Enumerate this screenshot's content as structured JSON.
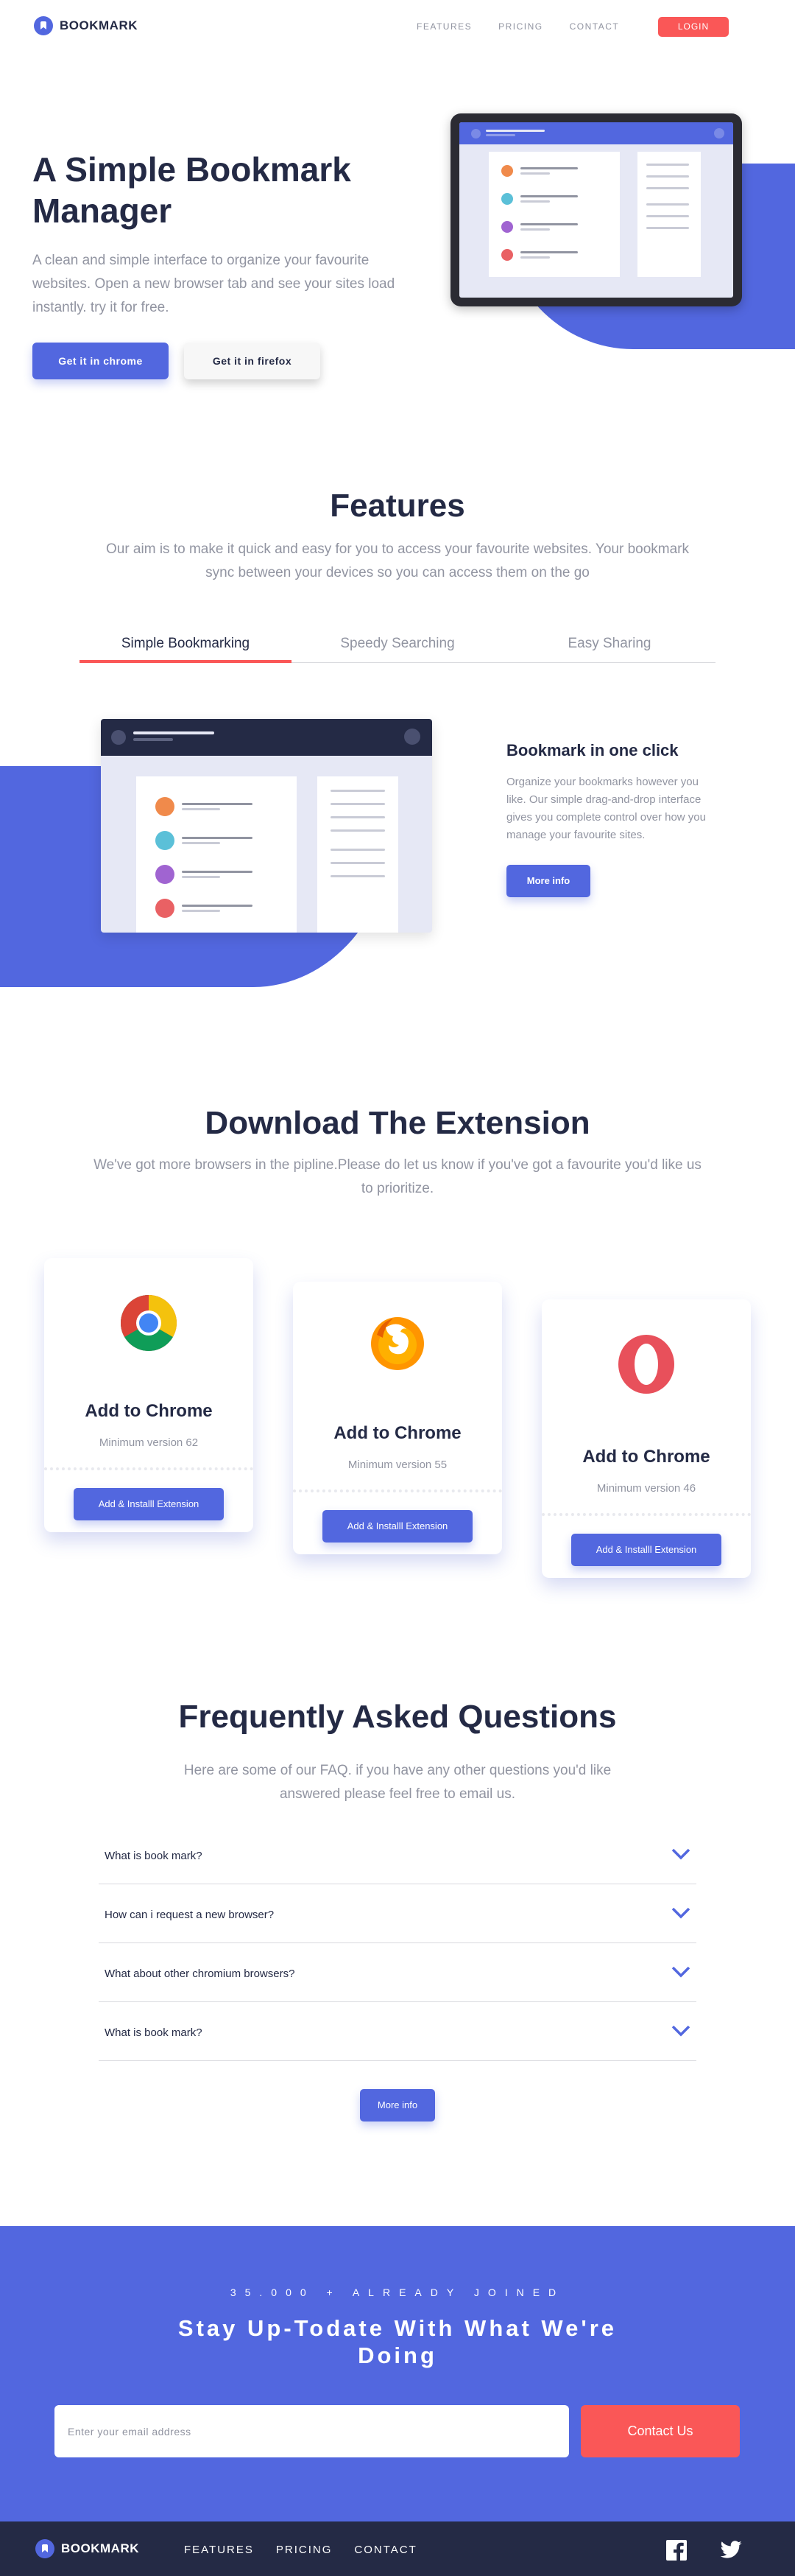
{
  "nav": {
    "logo_text": "BOOKMARK",
    "links": [
      "FEATURES",
      "PRICING",
      "CONTACT"
    ],
    "login": "LOGIN"
  },
  "hero": {
    "title": "A Simple Bookmark Manager",
    "text": "A clean and simple interface to organize your favourite websites. Open a new browser tab and see your sites load instantly. try it for free.",
    "btn_chrome": "Get it in chrome",
    "btn_firefox": "Get it in firefox"
  },
  "features": {
    "title": "Features",
    "subtitle": "Our aim is to make it quick and easy for you to access your favourite websites. Your bookmark sync between your devices so you can access them on the go",
    "tabs": [
      "Simple Bookmarking",
      "Speedy Searching",
      "Easy Sharing"
    ],
    "active_tab": "Simple Bookmarking",
    "panel": {
      "title": "Bookmark in one click",
      "text": "Organize your bookmarks however you like. Our simple drag-and-drop interface gives you complete control over how you manage your favourite sites.",
      "button": "More info"
    }
  },
  "download": {
    "title": "Download The Extension",
    "subtitle": "We've got more browsers in the pipline.Please do let us know if you've got a favourite you'd like us to prioritize.",
    "cards": [
      {
        "icon": "chrome-icon",
        "title": "Add to Chrome",
        "version": "Minimum version 62",
        "button": "Add & Installl Extension"
      },
      {
        "icon": "firefox-icon",
        "title": "Add to Chrome",
        "version": "Minimum version 55",
        "button": "Add & Installl Extension"
      },
      {
        "icon": "opera-icon",
        "title": "Add to Chrome",
        "version": "Minimum version 46",
        "button": "Add & Installl Extension"
      }
    ]
  },
  "faq": {
    "title": "Frequently Asked Questions",
    "subtitle": "Here are some of our FAQ. if you have any other questions you'd like answered please feel free to email us.",
    "questions": [
      "What is book mark?",
      "How can i request a new browser?",
      "What about other chromium browsers?",
      "What is book mark?"
    ],
    "more": "More info"
  },
  "cta": {
    "kicker": "35.000 + ALREADY JOINED",
    "title": "Stay Up-Todate With What We're Doing",
    "email_placeholder": "Enter your email address",
    "button": "Contact Us"
  },
  "footer": {
    "logo_text": "BOOKMARK",
    "links": [
      "FEATURES",
      "PRICING",
      "CONTACT"
    ],
    "social": [
      "facebook-icon",
      "twitter-icon"
    ]
  },
  "colors": {
    "primary": "#5267df",
    "accent": "#fa5757",
    "dark": "#242a45",
    "muted": "#9194a1"
  }
}
